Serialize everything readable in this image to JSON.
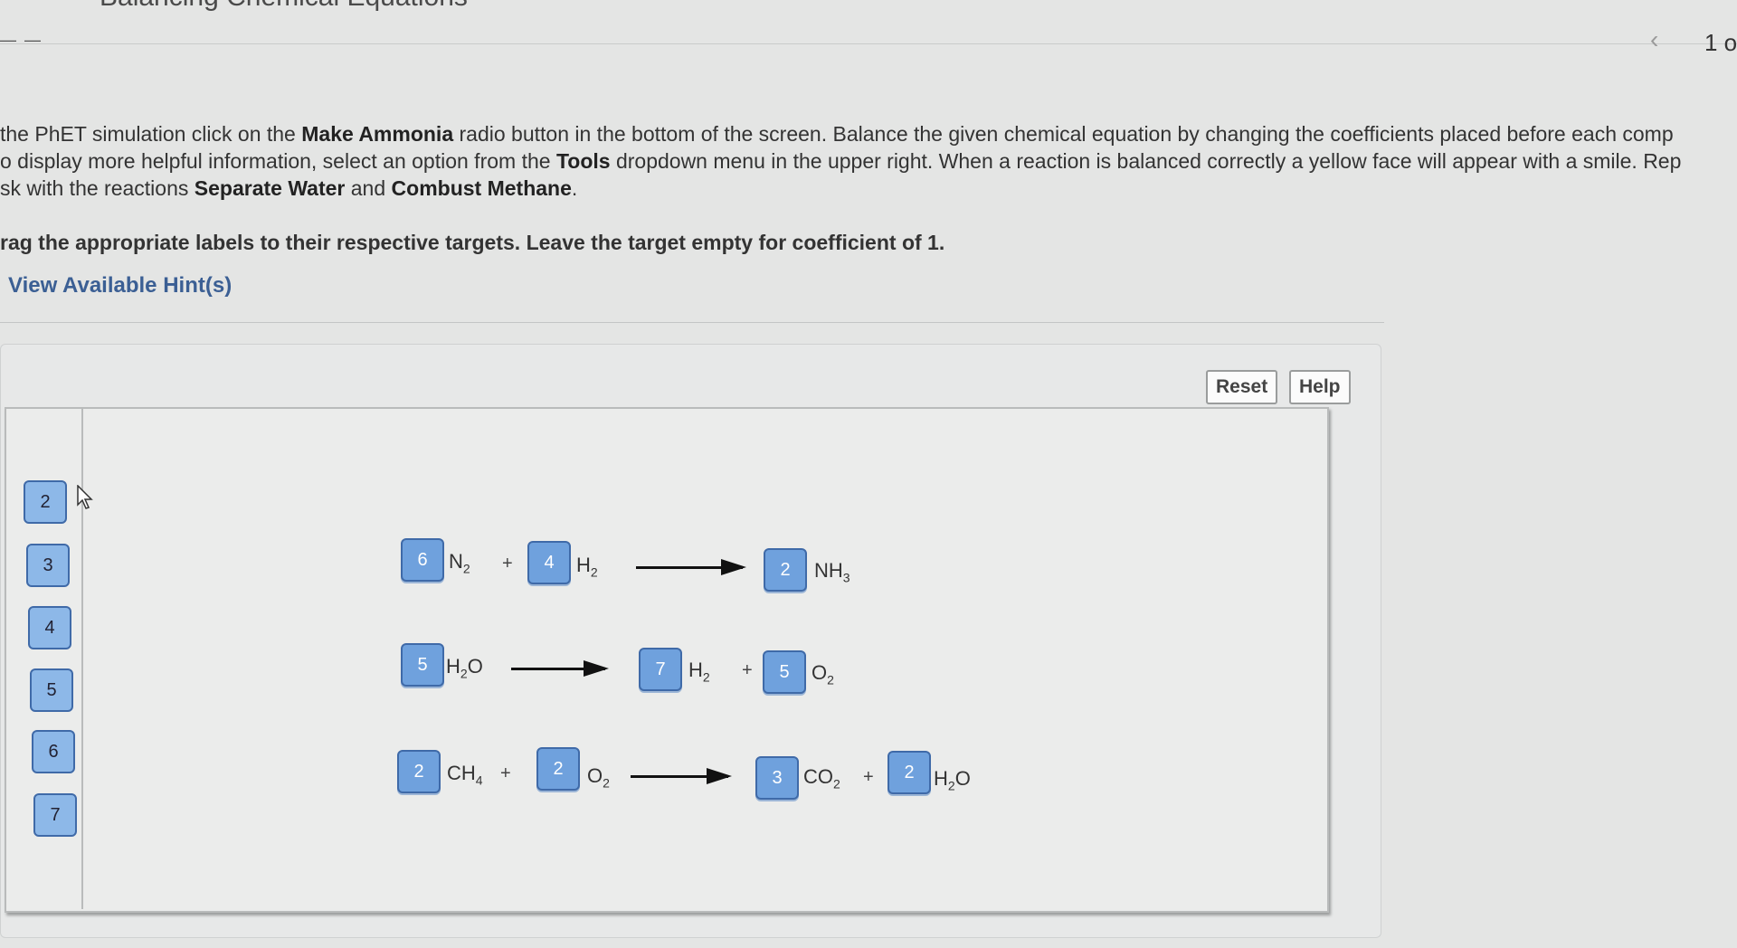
{
  "header": {
    "title": "Balancing Chemical Equations",
    "pager": "1 o"
  },
  "instructions": {
    "line1_a": "the PhET simulation click on the ",
    "line1_b": "Make Ammonia",
    "line1_c": " radio button in the bottom of the screen.  Balance the given chemical equation by changing the coefficients placed before each comp",
    "line2_a": "o display more helpful information, select an option from the ",
    "line2_b": "Tools",
    "line2_c": " dropdown menu in the upper right.  When a reaction is balanced correctly a yellow face will appear with a smile.  Rep",
    "line3_a": "sk with the reactions ",
    "line3_b": "Separate Water",
    "line3_c": " and ",
    "line3_d": "Combust Methane",
    "line3_e": ".",
    "drag": "rag the appropriate labels to their respective targets. Leave the target empty for coefficient of 1."
  },
  "hint_link": "View Available Hint(s)",
  "buttons": {
    "reset": "Reset",
    "help": "Help"
  },
  "label_bank": [
    "2",
    "3",
    "4",
    "5",
    "6",
    "7"
  ],
  "equations": {
    "eq1": {
      "c1": "6",
      "f1": "N",
      "s1": "2",
      "c2": "4",
      "f2": "H",
      "s2": "2",
      "c3": "2",
      "f3": "NH",
      "s3": "3"
    },
    "eq2": {
      "c1": "5",
      "f1a": "H",
      "s1": "2",
      "f1b": "O",
      "c2": "7",
      "f2": "H",
      "s2": "2",
      "c3": "5",
      "f3": "O",
      "s3": "2"
    },
    "eq3": {
      "c1": "2",
      "f1": "CH",
      "s1": "4",
      "c2": "2",
      "f2": "O",
      "s2": "2",
      "c3": "3",
      "f3": "CO",
      "s3": "2",
      "c4": "2",
      "f4a": "H",
      "s4": "2",
      "f4b": "O"
    },
    "plus": "+"
  },
  "icons": {
    "cursor": "pointer-cursor-icon",
    "prev": "chevron-left-icon"
  }
}
